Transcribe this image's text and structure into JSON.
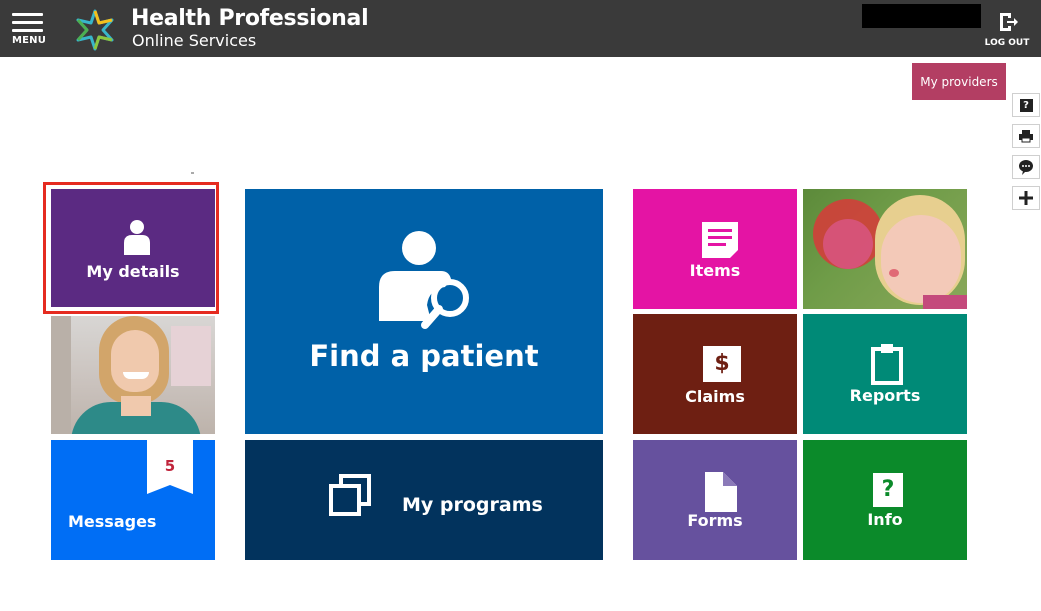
{
  "header": {
    "menu_label": "MENU",
    "brand_line1": "Health Professional",
    "brand_line2": "Online Services",
    "logout_label": "LOG OUT"
  },
  "my_providers_label": "My providers",
  "side_tools": [
    "help-icon",
    "print-icon",
    "chat-icon",
    "add-icon"
  ],
  "side_tools_help_glyph": "?",
  "tiles": {
    "my_details": {
      "label": "My details",
      "color": "#5b2a82"
    },
    "find_patient": {
      "label": "Find a patient",
      "color": "#0061a8"
    },
    "my_programs": {
      "label": "My programs",
      "color": "#02335d"
    },
    "messages": {
      "label": "Messages",
      "count": "5",
      "color": "#006ef5"
    },
    "items": {
      "label": "Items",
      "color": "#e414a4"
    },
    "claims": {
      "label": "Claims",
      "glyph": "$",
      "color": "#6e1f12"
    },
    "reports": {
      "label": "Reports",
      "color": "#008a77"
    },
    "forms": {
      "label": "Forms",
      "color": "#66519e"
    },
    "info": {
      "label": "Info",
      "glyph": "?",
      "color": "#0b8a2a"
    }
  },
  "colors": {
    "header_bg": "#3a3a3a",
    "my_providers_bg": "#b33e63",
    "selection_outline": "#e52b20"
  }
}
